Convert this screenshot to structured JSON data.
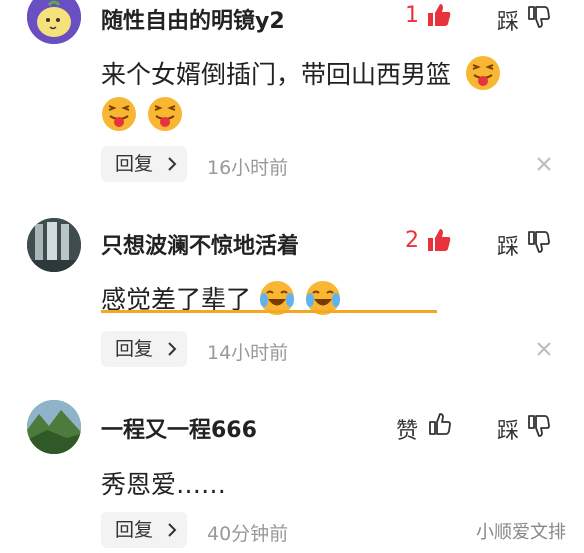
{
  "comments": [
    {
      "username": "随性自由的明镜y2",
      "likes": "1",
      "dislike_label": "踩",
      "text": "来个女婿倒插门，带回山西男篮",
      "reply_label": "回复",
      "time": "16小时前",
      "emoji": "tongue-wink-emoji"
    },
    {
      "username": "只想波澜不惊地活着",
      "likes": "2",
      "dislike_label": "踩",
      "text": "感觉差了辈了",
      "reply_label": "回复",
      "time": "14小时前",
      "emoji": "laugh-cry-emoji"
    },
    {
      "username": "一程又一程666",
      "like_label": "赞",
      "dislike_label": "踩",
      "text": "秀恩爱……",
      "reply_label": "回复",
      "time": "40分钟前"
    }
  ],
  "watermark": "小顺爱文排",
  "colors": {
    "like_red": "#e8323c",
    "underline": "#f5a623",
    "avatar1_bg": "#6a4fc2"
  }
}
